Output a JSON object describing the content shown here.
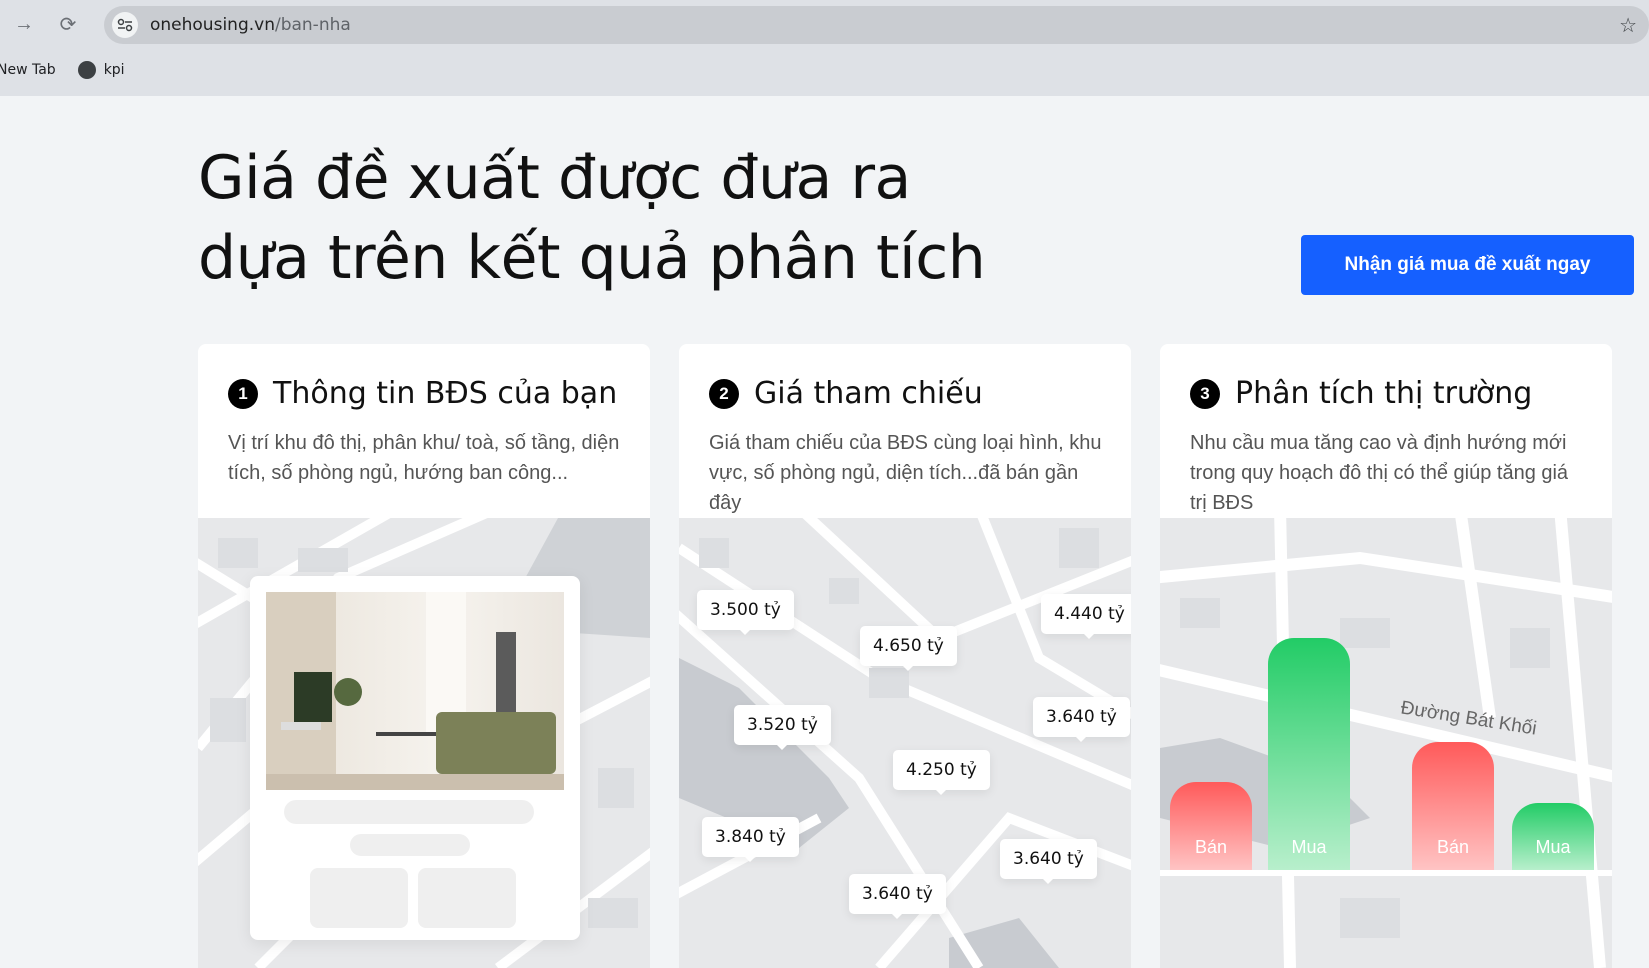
{
  "browser": {
    "url_host": "onehousing.vn",
    "url_path": "/ban-nha",
    "bookmarks": [
      "New Tab",
      "kpi"
    ]
  },
  "hero": {
    "title": "Giá đề xuất được đưa ra dựa trên kết quả phân tích",
    "cta": "Nhận giá mua đề xuất ngay"
  },
  "cards": [
    {
      "number": "1",
      "title": "Thông tin BĐS của bạn",
      "description": "Vị trí khu đô thị, phân khu/ toà, số tầng, diện tích, số phòng ngủ, hướng ban công..."
    },
    {
      "number": "2",
      "title": "Giá tham chiếu",
      "description": "Giá tham chiếu của BĐS cùng loại hình, khu vực, số phòng ngủ, diện tích...đã bán gần đây",
      "prices": [
        "3.500 tỷ",
        "4.650 tỷ",
        "4.440 tỷ",
        "3.520 tỷ",
        "3.640 tỷ",
        "4.250 tỷ",
        "3.840 tỷ",
        "3.640 tỷ",
        "3.640 tỷ"
      ]
    },
    {
      "number": "3",
      "title": "Phân tích thị trường",
      "description": "Nhu cầu mua tăng cao và định hướng mới trong quy hoạch đô thị có thể giúp tăng giá trị BĐS",
      "street": "Đường Bát Khối",
      "bars": [
        {
          "label": "Bán",
          "level": 0.38
        },
        {
          "label": "Mua",
          "level": 1.0
        },
        {
          "label": "Bán",
          "level": 0.55
        },
        {
          "label": "Mua",
          "level": 0.29
        }
      ],
      "colors": {
        "sell": "#ff5a5a",
        "buy": "#22cc66"
      }
    }
  ],
  "colors": {
    "accent": "#1560ff",
    "background": "#f2f4f6"
  }
}
